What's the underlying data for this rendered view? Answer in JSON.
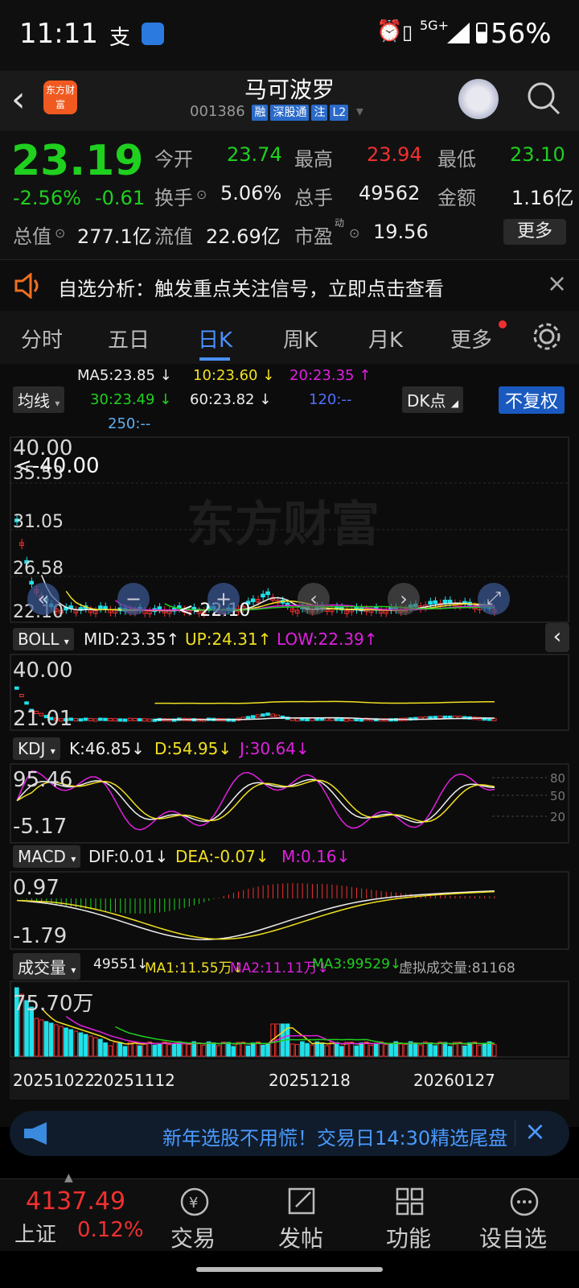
{
  "status": {
    "time": "11:11",
    "network": "5G+",
    "battery": "56%"
  },
  "header": {
    "title": "马可波罗",
    "code": "001386",
    "tags": [
      "融",
      "深股通",
      "注",
      "L2"
    ],
    "logo_text": "东方财富"
  },
  "quote": {
    "price": "23.19",
    "change_pct": "-2.56%",
    "change": "-0.61",
    "open_label": "今开",
    "open": "23.74",
    "high_label": "最高",
    "high": "23.94",
    "low_label": "最低",
    "low": "23.10",
    "turnover_label": "换手",
    "turnover": "5.06%",
    "volume_label": "总手",
    "volume": "49562",
    "amount_label": "金额",
    "amount": "1.16亿",
    "mktcap_label": "总值",
    "mktcap": "277.1亿",
    "float_label": "流值",
    "float": "22.69亿",
    "pe_label": "市盈",
    "pe_sup": "动",
    "pe": "19.56",
    "more_button": "更多"
  },
  "notice": {
    "text": "自选分析：触发重点关注信号，立即点击查看"
  },
  "tabs": {
    "items": [
      "分时",
      "五日",
      "日K",
      "周K",
      "月K",
      "更多"
    ],
    "active": "日K"
  },
  "ma": {
    "selector": "均线",
    "ma5": "MA5:23.85 ↓",
    "ma10": "10:23.60 ↓",
    "ma20": "20:23.35 ↑",
    "ma30": "30:23.49 ↓",
    "ma60": "60:23.82 ↓",
    "ma120": "120:--",
    "ma250": "250:--",
    "dk": "DK点",
    "adjust": "不复权"
  },
  "main_chart": {
    "max_label": "40.00",
    "y1": "35.53",
    "y2": "31.05",
    "y3": "26.58",
    "min_label": "22.10",
    "max_marker": "<-40.00",
    "min_marker": "<-22.10",
    "watermark": "东方财富"
  },
  "boll": {
    "name": "BOLL",
    "mid": "MID:23.35↑",
    "up": "UP:24.31↑",
    "low": "LOW:22.39↑",
    "y_top": "40.00",
    "y_bot": "21.01"
  },
  "kdj": {
    "name": "KDJ",
    "k": "K:46.85↓",
    "d": "D:54.95↓",
    "j": "J:30.64↓",
    "y_top": "95.46",
    "y_bot": "-5.17",
    "levels": [
      "80",
      "50",
      "20"
    ]
  },
  "macd": {
    "name": "MACD",
    "dif": "DIF:0.01↓",
    "dea": "DEA:-0.07↓",
    "m": "M:0.16↓",
    "y_top": "0.97",
    "y_bot": "-1.79"
  },
  "vol": {
    "name": "成交量",
    "v": "49551↓",
    "ma1": "MA1:11.55万↓",
    "ma2": "MA2:11.11万↓",
    "ma3": "MA3:99529↓",
    "virtual": "虚拟成交量:81168",
    "y_top": "75.70万"
  },
  "dates": [
    "20251022",
    "20251112",
    "20251218",
    "20260127"
  ],
  "banner": {
    "text": "新年选股不用慌！交易日14:30精选尾盘"
  },
  "footer": {
    "index_value": "4137.49",
    "index_name": "上证",
    "index_change": "0.12%",
    "items": [
      "交易",
      "发帖",
      "功能",
      "设自选"
    ]
  },
  "colors": {
    "up": "#f03030",
    "down": "#1fd01f",
    "accent": "#2a6ac9",
    "yellow": "#f0e020",
    "magenta": "#e020e0",
    "cyan": "#20e0e8"
  }
}
